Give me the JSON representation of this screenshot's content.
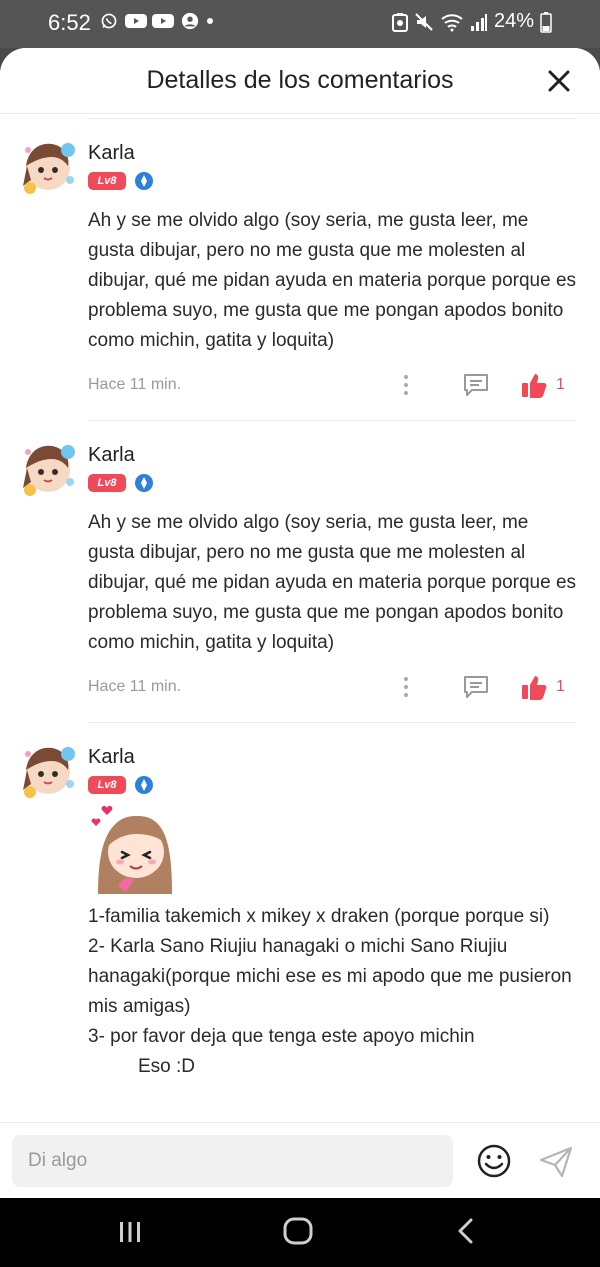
{
  "status_bar": {
    "time": "6:52",
    "battery": "24%",
    "left_icons": [
      "whatsapp-icon",
      "youtube-icon",
      "youtube-icon",
      "account-icon",
      "dot-icon"
    ],
    "right_icons": [
      "data-saver-icon",
      "mute-icon",
      "wifi-icon",
      "signal-icon",
      "battery-icon"
    ]
  },
  "sheet": {
    "title": "Detalles de los comentarios",
    "close_icon": "close-icon"
  },
  "comments": [
    {
      "author": "Karla",
      "level": "Lv8",
      "text": "Ah y se me olvido algo (soy seria, me gusta leer, me gusta dibujar, pero no me gusta que me molesten al dibujar, qué me pidan ayuda en materia porque porque es problema suyo, me gusta que me pongan apodos bonito como michin, gatita y loquita)",
      "time": "Hace 11 min.",
      "likes": "1"
    },
    {
      "author": "Karla",
      "level": "Lv8",
      "text": "Ah y se me olvido algo (soy seria, me gusta leer, me gusta dibujar, pero no me gusta que me molesten al dibujar, qué me pidan ayuda en materia porque porque es problema suyo, me gusta que me pongan apodos bonito como michin, gatita y loquita)",
      "time": "Hace 11 min.",
      "likes": "1"
    },
    {
      "author": "Karla",
      "level": "Lv8",
      "lines": [
        "1-familia takemich x mikey x draken (porque porque si)",
        "2- Karla Sano Riujiu hanagaki o michi Sano Riujiu hanagaki(porque michi ese es mi apodo que me pusieron mis amigas)",
        "3- por favor deja que tenga este apoyo michin",
        "Eso :D"
      ]
    }
  ],
  "input": {
    "placeholder": "Di algo"
  },
  "colors": {
    "accent": "#f04a5a",
    "verified": "#2f80d8",
    "muted_text": "#9a9a9a"
  }
}
